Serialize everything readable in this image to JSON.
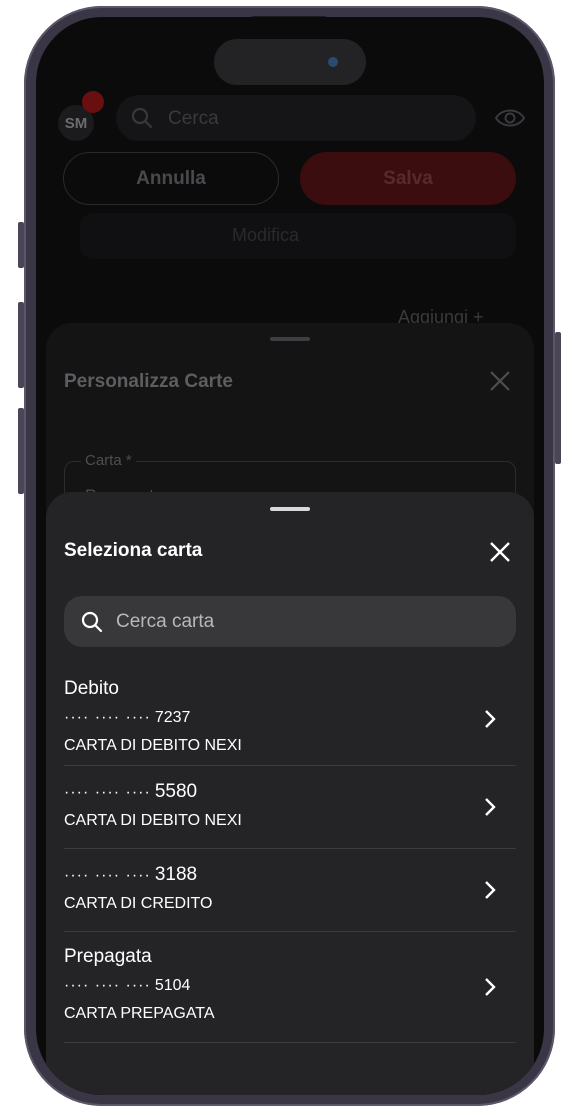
{
  "background_app": {
    "avatar_initials": "SM",
    "search_placeholder": "Cerca",
    "cancel_label": "Annulla",
    "save_label": "Salva",
    "edit_label": "Modifica",
    "add_label": "Aggiungi +"
  },
  "customize_sheet": {
    "title": "Personalizza Carte",
    "field_label": "Carta *",
    "field_value": "Prepagata"
  },
  "select_sheet": {
    "title": "Seleziona carta",
    "search_placeholder": "Cerca carta",
    "items": [
      {
        "category": "Debito",
        "mask": "···· ···· ····",
        "last4": "7237",
        "description": "CARTA DI DEBITO NEXI"
      },
      {
        "category": "",
        "mask": "···· ···· ····",
        "last4": "5580",
        "description": "CARTA DI DEBITO NEXI"
      },
      {
        "category": "",
        "mask": "···· ···· ····",
        "last4": "3188",
        "description": "CARTA DI CREDITO"
      },
      {
        "category": "Prepagata",
        "mask": "···· ···· ····",
        "last4": "5104",
        "description": "CARTA PREPAGATA"
      }
    ]
  },
  "icons": [
    "search-icon",
    "eye-icon",
    "close-icon",
    "chevron-right-icon",
    "pencil-icon"
  ],
  "colors": {
    "sheet_bg": "#242426",
    "search_bg": "#38383b",
    "text": "#ffffff",
    "save_accent": "#3b0d0e"
  }
}
